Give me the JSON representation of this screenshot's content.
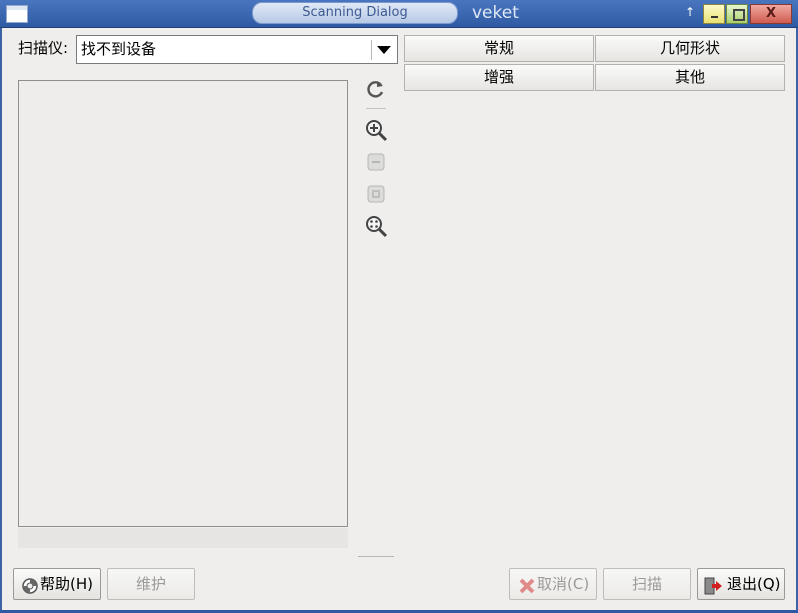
{
  "window": {
    "title": "Scanning Dialog",
    "brand": "veket",
    "up_glyph": "↑",
    "close_glyph": "X"
  },
  "scanner": {
    "label": "扫描仪:",
    "value": "找不到设备"
  },
  "tabs": [
    {
      "label": "常规"
    },
    {
      "label": "几何形状"
    },
    {
      "label": "增强"
    },
    {
      "label": "其他"
    }
  ],
  "toolbar": {
    "icons": [
      "refresh-icon",
      "zoom-in-icon",
      "zoom-out-icon",
      "zoom-selection-icon",
      "zoom-fit-icon"
    ]
  },
  "buttons": {
    "help": {
      "label": "帮助(H)",
      "icon": "lifebuoy-icon",
      "enabled": true
    },
    "maintenance": {
      "label": "维护",
      "enabled": false
    },
    "cancel": {
      "label": "取消(C)",
      "icon": "cancel-x-icon",
      "enabled": false
    },
    "scan": {
      "label": "扫描",
      "enabled": false
    },
    "quit": {
      "label": "退出(Q)",
      "icon": "exit-door-icon",
      "enabled": true
    }
  },
  "colors": {
    "titlebar": "#2f5aa3",
    "background": "#efeeec",
    "disabled_text": "#9b9a97",
    "cancel_icon": "#d23b3b",
    "quit_arrow": "#d02020"
  }
}
